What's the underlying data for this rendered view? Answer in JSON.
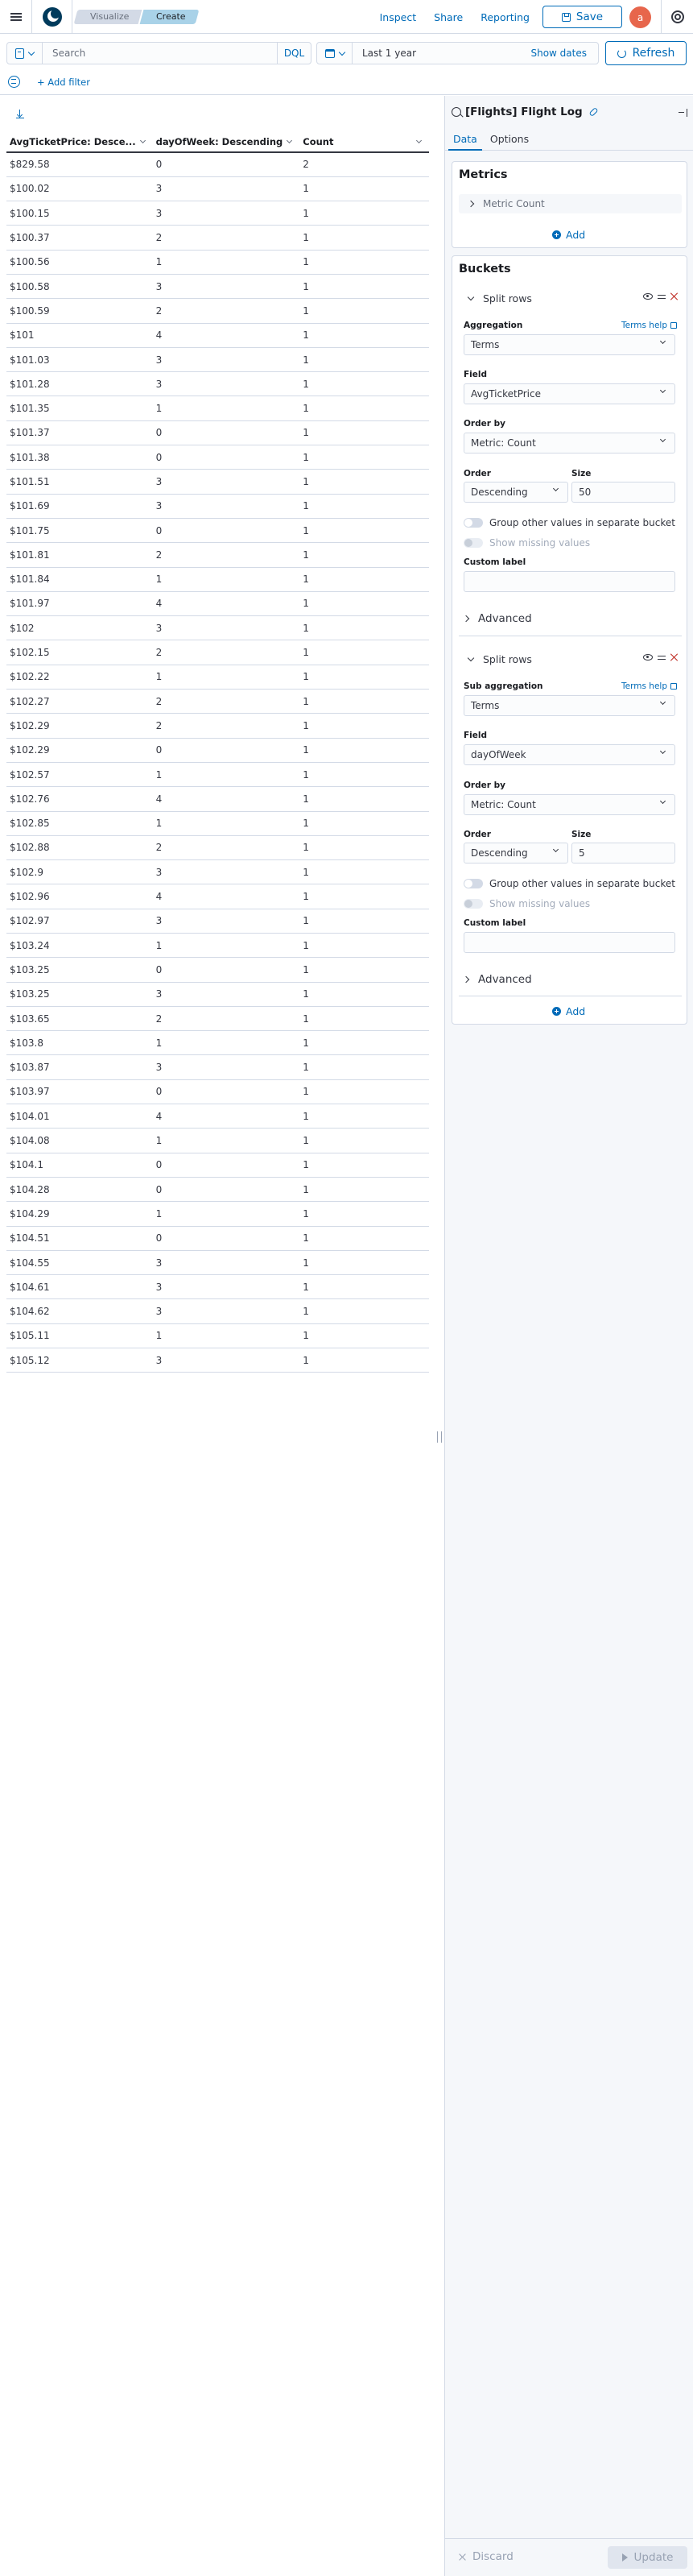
{
  "header": {
    "breadcrumbs": [
      "Visualize",
      "Create"
    ],
    "links": [
      "Inspect",
      "Share",
      "Reporting"
    ],
    "save_label": "Save",
    "avatar_initial": "a"
  },
  "query": {
    "search_placeholder": "Search",
    "language": "DQL",
    "date_range": "Last 1 year",
    "show_dates": "Show dates",
    "refresh_label": "Refresh"
  },
  "filter": {
    "add_filter": "+ Add filter"
  },
  "table": {
    "columns": [
      "AvgTicketPrice: Desce...",
      "dayOfWeek: Descending",
      "Count"
    ],
    "rows": [
      [
        "$829.58",
        "0",
        "2"
      ],
      [
        "$100.02",
        "3",
        "1"
      ],
      [
        "$100.15",
        "3",
        "1"
      ],
      [
        "$100.37",
        "2",
        "1"
      ],
      [
        "$100.56",
        "1",
        "1"
      ],
      [
        "$100.58",
        "3",
        "1"
      ],
      [
        "$100.59",
        "2",
        "1"
      ],
      [
        "$101",
        "4",
        "1"
      ],
      [
        "$101.03",
        "3",
        "1"
      ],
      [
        "$101.28",
        "3",
        "1"
      ],
      [
        "$101.35",
        "1",
        "1"
      ],
      [
        "$101.37",
        "0",
        "1"
      ],
      [
        "$101.38",
        "0",
        "1"
      ],
      [
        "$101.51",
        "3",
        "1"
      ],
      [
        "$101.69",
        "3",
        "1"
      ],
      [
        "$101.75",
        "0",
        "1"
      ],
      [
        "$101.81",
        "2",
        "1"
      ],
      [
        "$101.84",
        "1",
        "1"
      ],
      [
        "$101.97",
        "4",
        "1"
      ],
      [
        "$102",
        "3",
        "1"
      ],
      [
        "$102.15",
        "2",
        "1"
      ],
      [
        "$102.22",
        "1",
        "1"
      ],
      [
        "$102.27",
        "2",
        "1"
      ],
      [
        "$102.29",
        "2",
        "1"
      ],
      [
        "$102.29",
        "0",
        "1"
      ],
      [
        "$102.57",
        "1",
        "1"
      ],
      [
        "$102.76",
        "4",
        "1"
      ],
      [
        "$102.85",
        "1",
        "1"
      ],
      [
        "$102.88",
        "2",
        "1"
      ],
      [
        "$102.9",
        "3",
        "1"
      ],
      [
        "$102.96",
        "4",
        "1"
      ],
      [
        "$102.97",
        "3",
        "1"
      ],
      [
        "$103.24",
        "1",
        "1"
      ],
      [
        "$103.25",
        "0",
        "1"
      ],
      [
        "$103.25",
        "3",
        "1"
      ],
      [
        "$103.65",
        "2",
        "1"
      ],
      [
        "$103.8",
        "1",
        "1"
      ],
      [
        "$103.87",
        "3",
        "1"
      ],
      [
        "$103.97",
        "0",
        "1"
      ],
      [
        "$104.01",
        "4",
        "1"
      ],
      [
        "$104.08",
        "1",
        "1"
      ],
      [
        "$104.1",
        "0",
        "1"
      ],
      [
        "$104.28",
        "0",
        "1"
      ],
      [
        "$104.29",
        "1",
        "1"
      ],
      [
        "$104.51",
        "0",
        "1"
      ],
      [
        "$104.55",
        "3",
        "1"
      ],
      [
        "$104.61",
        "3",
        "1"
      ],
      [
        "$104.62",
        "3",
        "1"
      ],
      [
        "$105.11",
        "1",
        "1"
      ],
      [
        "$105.12",
        "3",
        "1"
      ]
    ]
  },
  "sidebar": {
    "title": "[Flights] Flight Log",
    "tabs": [
      "Data",
      "Options"
    ],
    "metrics": {
      "title": "Metrics",
      "item": "Metric Count",
      "add": "Add"
    },
    "buckets": {
      "title": "Buckets",
      "aggs": [
        {
          "header": "Split rows",
          "agg_label": "Aggregation",
          "help": "Terms help",
          "agg_value": "Terms",
          "field_label": "Field",
          "field_value": "AvgTicketPrice",
          "order_by_label": "Order by",
          "order_by_value": "Metric: Count",
          "order_label": "Order",
          "order_value": "Descending",
          "size_label": "Size",
          "size_value": "50",
          "group_other": "Group other values in separate bucket",
          "show_missing": "Show missing values",
          "custom_label": "Custom label",
          "advanced": "Advanced"
        },
        {
          "header": "Split rows",
          "agg_label": "Sub aggregation",
          "help": "Terms help",
          "agg_value": "Terms",
          "field_label": "Field",
          "field_value": "dayOfWeek",
          "order_by_label": "Order by",
          "order_by_value": "Metric: Count",
          "order_label": "Order",
          "order_value": "Descending",
          "size_label": "Size",
          "size_value": "5",
          "group_other": "Group other values in separate bucket",
          "show_missing": "Show missing values",
          "custom_label": "Custom label",
          "advanced": "Advanced"
        }
      ],
      "add": "Add"
    },
    "footer": {
      "discard": "Discard",
      "update": "Update"
    }
  }
}
